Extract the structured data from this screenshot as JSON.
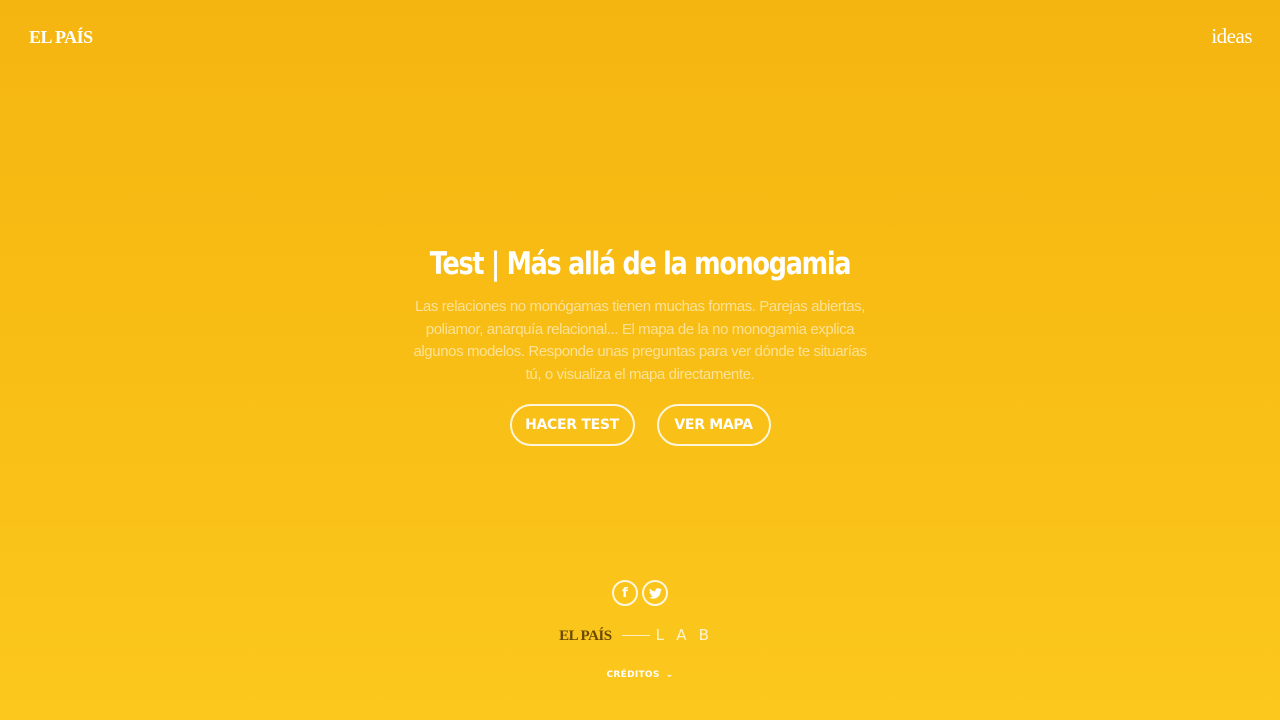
{
  "header": {
    "logo_left": "EL PAÍS",
    "logo_right": "ideas"
  },
  "hero": {
    "title": "Test | Más allá de la monogamia",
    "description": "Las relaciones no monógamas tienen muchas formas. Parejas abiertas, poliamor, anarquía relacional... El mapa de la no monogamia explica algunos modelos. Responde unas preguntas para ver dónde te situarías tú, o visualiza el mapa directamente.",
    "buttons": {
      "test_label": "HACER TEST",
      "map_label": "VER MAPA"
    }
  },
  "footer": {
    "social": {
      "facebook_glyph": "f"
    },
    "brand": {
      "elpais": "EL PAÍS",
      "lab": "LAB"
    },
    "credits_label": "CRÉDITOS",
    "credits_chevron": "⌄"
  },
  "colors": {
    "background_top": "#f5b511",
    "background_bottom": "#fcc81d",
    "foreground": "#ffffff",
    "brand_dark": "#6b4a00"
  },
  "icons": {
    "facebook": "facebook-icon",
    "twitter": "twitter-icon",
    "credits_toggle": "chevron-down-icon"
  }
}
